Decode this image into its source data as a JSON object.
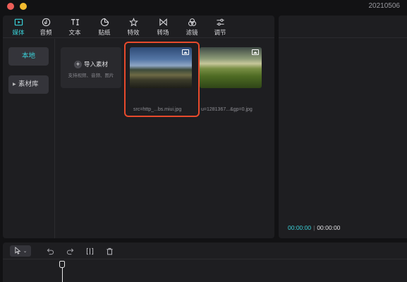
{
  "window": {
    "version": "20210506"
  },
  "toolbar": {
    "items": [
      {
        "label": "媒体",
        "icon": "media-play-icon",
        "active": true
      },
      {
        "label": "音频",
        "icon": "audio-note-icon",
        "active": false
      },
      {
        "label": "文本",
        "icon": "text-ti-icon",
        "active": false
      },
      {
        "label": "贴纸",
        "icon": "sticker-icon",
        "active": false
      },
      {
        "label": "特效",
        "icon": "effects-star-icon",
        "active": false
      },
      {
        "label": "转场",
        "icon": "transition-bowtie-icon",
        "active": false
      },
      {
        "label": "滤镜",
        "icon": "filter-circles-icon",
        "active": false
      },
      {
        "label": "调节",
        "icon": "adjust-sliders-icon",
        "active": false
      }
    ]
  },
  "sidebar": {
    "local": "本地",
    "library": "素材库"
  },
  "library": {
    "import_title": "导入素材",
    "import_subtitle": "支持视频、音频、图片",
    "items": [
      {
        "filename": "src=http_...bs.miui.jpg",
        "type_icon": "image-icon",
        "selected": true
      },
      {
        "filename": "u=1281367...&gp=0.jpg",
        "type_icon": "image-icon",
        "selected": false
      }
    ],
    "highlight_color": "#e84a2c"
  },
  "preview": {
    "current_time": "00:00:00",
    "total_time": "00:00:00"
  },
  "timeline": {
    "tools": [
      "pointer-select-icon",
      "undo-icon",
      "redo-icon",
      "split-icon",
      "delete-icon"
    ]
  },
  "colors": {
    "accent": "#3ad1d8",
    "panel": "#1e1e21",
    "background": "#121214"
  }
}
